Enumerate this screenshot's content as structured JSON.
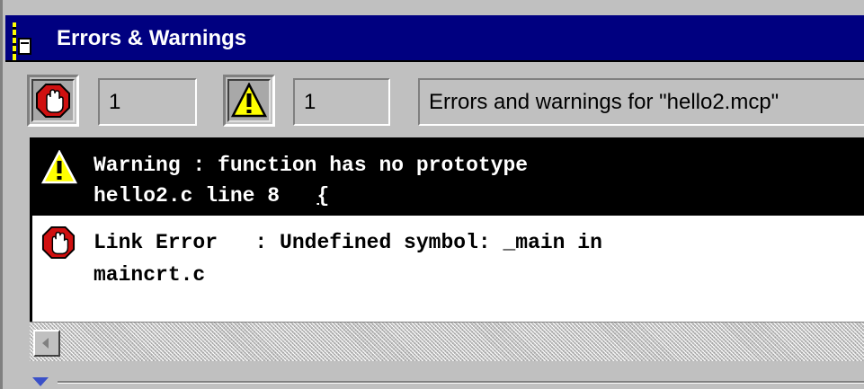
{
  "window": {
    "title": "Errors & Warnings"
  },
  "toolbar": {
    "error_count": "1",
    "warning_count": "1",
    "description": "Errors and warnings for \"hello2.mcp\""
  },
  "messages": [
    {
      "type": "warning",
      "icon": "warning-icon",
      "line1": "Warning : function has no prototype",
      "file_line": "hello2.c line 8   ",
      "code": "{",
      "selected": true
    },
    {
      "type": "error",
      "icon": "stop-hand-icon",
      "line1": "Link Error   : Undefined symbol: _main in",
      "line2": "maincrt.c",
      "selected": false
    }
  ],
  "colors": {
    "title_bar": "#000080",
    "error_red": "#d01010",
    "warning_yellow": "#ffff00",
    "selected_row": "#000000"
  }
}
